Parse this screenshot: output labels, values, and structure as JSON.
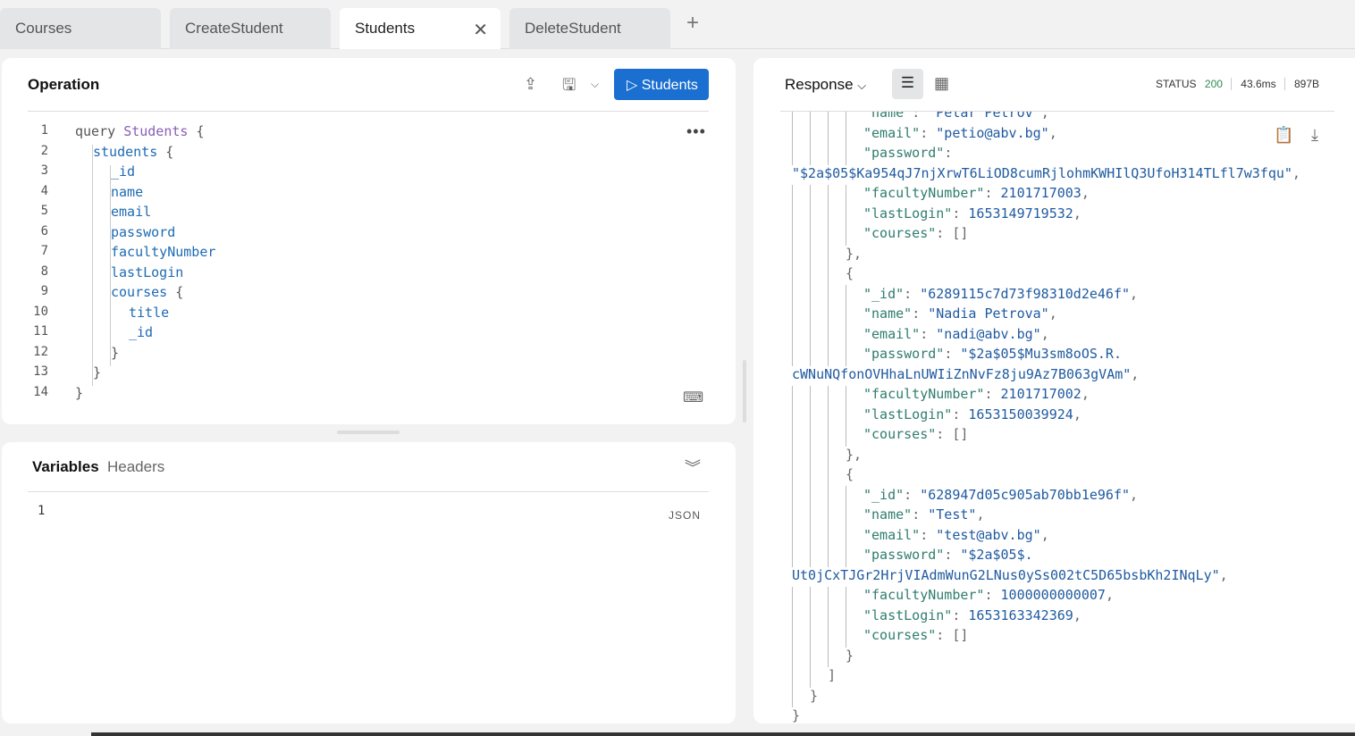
{
  "tabs": [
    {
      "label": "Courses"
    },
    {
      "label": "CreateStudent"
    },
    {
      "label": "Students",
      "active": true
    },
    {
      "label": "DeleteStudent"
    }
  ],
  "new_tab_icon": "plus-icon",
  "operation": {
    "title": "Operation",
    "run_label": "▷ Students",
    "more": "•••",
    "lines": [
      {
        "n": "1",
        "indent": 0,
        "tokens": [
          [
            "kw",
            "query "
          ],
          [
            "nm",
            "Students"
          ],
          [
            "kw",
            " {"
          ]
        ]
      },
      {
        "n": "2",
        "indent": 1,
        "tokens": [
          [
            "fd",
            "students"
          ],
          [
            "kw",
            " {"
          ]
        ]
      },
      {
        "n": "3",
        "indent": 2,
        "tokens": [
          [
            "fd",
            "_id"
          ]
        ]
      },
      {
        "n": "4",
        "indent": 2,
        "tokens": [
          [
            "fd",
            "name"
          ]
        ]
      },
      {
        "n": "5",
        "indent": 2,
        "tokens": [
          [
            "fd",
            "email"
          ]
        ]
      },
      {
        "n": "6",
        "indent": 2,
        "tokens": [
          [
            "fd",
            "password"
          ]
        ]
      },
      {
        "n": "7",
        "indent": 2,
        "tokens": [
          [
            "fd",
            "facultyNumber"
          ]
        ]
      },
      {
        "n": "8",
        "indent": 2,
        "tokens": [
          [
            "fd",
            "lastLogin"
          ]
        ]
      },
      {
        "n": "9",
        "indent": 2,
        "tokens": [
          [
            "fd",
            "courses"
          ],
          [
            "kw",
            " {"
          ]
        ]
      },
      {
        "n": "10",
        "indent": 3,
        "tokens": [
          [
            "fd",
            "title"
          ]
        ]
      },
      {
        "n": "11",
        "indent": 3,
        "tokens": [
          [
            "fd",
            "_id"
          ]
        ]
      },
      {
        "n": "12",
        "indent": 2,
        "tokens": [
          [
            "kw",
            "}"
          ]
        ]
      },
      {
        "n": "13",
        "indent": 1,
        "tokens": [
          [
            "kw",
            "}"
          ]
        ]
      },
      {
        "n": "14",
        "indent": 0,
        "tokens": [
          [
            "kw",
            "}"
          ]
        ]
      }
    ]
  },
  "variables": {
    "tab_variables": "Variables",
    "tab_headers": "Headers",
    "line": "1",
    "mode": "JSON"
  },
  "response": {
    "title": "Response",
    "status_label": "STATUS",
    "status": "200",
    "time": "43.6ms",
    "size": "897B",
    "colors": {
      "status": "#2e8b57",
      "key": "#2f7d6e",
      "value": "#1f5aa0"
    },
    "lines": [
      {
        "i": 4,
        "t": [
          [
            "key",
            "\"name\""
          ],
          [
            "pun",
            ": "
          ],
          [
            "val",
            "\"Petar Petrov\""
          ],
          [
            "pun",
            ","
          ]
        ]
      },
      {
        "i": 4,
        "t": [
          [
            "key",
            "\"email\""
          ],
          [
            "pun",
            ": "
          ],
          [
            "val",
            "\"petio@abv.bg\""
          ],
          [
            "pun",
            ","
          ]
        ]
      },
      {
        "i": 4,
        "t": [
          [
            "key",
            "\"password\""
          ],
          [
            "pun",
            ":"
          ]
        ]
      },
      {
        "i": 0,
        "t": [
          [
            "val",
            "\"$2a$05$Ka954qJ7njXrwT6LiOD8cumRjlohmKWHIlQ3UfoH314TLfl7w3fqu\""
          ],
          [
            "pun",
            ","
          ]
        ]
      },
      {
        "i": 4,
        "t": [
          [
            "key",
            "\"facultyNumber\""
          ],
          [
            "pun",
            ": "
          ],
          [
            "val",
            "2101717003"
          ],
          [
            "pun",
            ","
          ]
        ]
      },
      {
        "i": 4,
        "t": [
          [
            "key",
            "\"lastLogin\""
          ],
          [
            "pun",
            ": "
          ],
          [
            "val",
            "1653149719532"
          ],
          [
            "pun",
            ","
          ]
        ]
      },
      {
        "i": 4,
        "t": [
          [
            "key",
            "\"courses\""
          ],
          [
            "pun",
            ": []"
          ]
        ]
      },
      {
        "i": 3,
        "t": [
          [
            "pun",
            "},"
          ]
        ]
      },
      {
        "i": 3,
        "t": [
          [
            "pun",
            "{"
          ]
        ]
      },
      {
        "i": 4,
        "t": [
          [
            "key",
            "\"_id\""
          ],
          [
            "pun",
            ": "
          ],
          [
            "val",
            "\"6289115c7d73f98310d2e46f\""
          ],
          [
            "pun",
            ","
          ]
        ]
      },
      {
        "i": 4,
        "t": [
          [
            "key",
            "\"name\""
          ],
          [
            "pun",
            ": "
          ],
          [
            "val",
            "\"Nadia Petrova\""
          ],
          [
            "pun",
            ","
          ]
        ]
      },
      {
        "i": 4,
        "t": [
          [
            "key",
            "\"email\""
          ],
          [
            "pun",
            ": "
          ],
          [
            "val",
            "\"nadi@abv.bg\""
          ],
          [
            "pun",
            ","
          ]
        ]
      },
      {
        "i": 4,
        "t": [
          [
            "key",
            "\"password\""
          ],
          [
            "pun",
            ": "
          ],
          [
            "val",
            "\"$2a$05$Mu3sm8oOS.R."
          ]
        ]
      },
      {
        "i": 0,
        "t": [
          [
            "val",
            "cWNuNQfonOVHhaLnUWIiZnNvFz8ju9Az7B063gVAm\""
          ],
          [
            "pun",
            ","
          ]
        ]
      },
      {
        "i": 4,
        "t": [
          [
            "key",
            "\"facultyNumber\""
          ],
          [
            "pun",
            ": "
          ],
          [
            "val",
            "2101717002"
          ],
          [
            "pun",
            ","
          ]
        ]
      },
      {
        "i": 4,
        "t": [
          [
            "key",
            "\"lastLogin\""
          ],
          [
            "pun",
            ": "
          ],
          [
            "val",
            "1653150039924"
          ],
          [
            "pun",
            ","
          ]
        ]
      },
      {
        "i": 4,
        "t": [
          [
            "key",
            "\"courses\""
          ],
          [
            "pun",
            ": []"
          ]
        ]
      },
      {
        "i": 3,
        "t": [
          [
            "pun",
            "},"
          ]
        ]
      },
      {
        "i": 3,
        "t": [
          [
            "pun",
            "{"
          ]
        ]
      },
      {
        "i": 4,
        "t": [
          [
            "key",
            "\"_id\""
          ],
          [
            "pun",
            ": "
          ],
          [
            "val",
            "\"628947d05c905ab70bb1e96f\""
          ],
          [
            "pun",
            ","
          ]
        ]
      },
      {
        "i": 4,
        "t": [
          [
            "key",
            "\"name\""
          ],
          [
            "pun",
            ": "
          ],
          [
            "val",
            "\"Test\""
          ],
          [
            "pun",
            ","
          ]
        ]
      },
      {
        "i": 4,
        "t": [
          [
            "key",
            "\"email\""
          ],
          [
            "pun",
            ": "
          ],
          [
            "val",
            "\"test@abv.bg\""
          ],
          [
            "pun",
            ","
          ]
        ]
      },
      {
        "i": 4,
        "t": [
          [
            "key",
            "\"password\""
          ],
          [
            "pun",
            ": "
          ],
          [
            "val",
            "\"$2a$05$."
          ]
        ]
      },
      {
        "i": 0,
        "t": [
          [
            "val",
            "Ut0jCxTJGr2HrjVIAdmWunG2LNus0ySs002tC5D65bsbKh2INqLy\""
          ],
          [
            "pun",
            ","
          ]
        ]
      },
      {
        "i": 4,
        "t": [
          [
            "key",
            "\"facultyNumber\""
          ],
          [
            "pun",
            ": "
          ],
          [
            "val",
            "1000000000007"
          ],
          [
            "pun",
            ","
          ]
        ]
      },
      {
        "i": 4,
        "t": [
          [
            "key",
            "\"lastLogin\""
          ],
          [
            "pun",
            ": "
          ],
          [
            "val",
            "1653163342369"
          ],
          [
            "pun",
            ","
          ]
        ]
      },
      {
        "i": 4,
        "t": [
          [
            "key",
            "\"courses\""
          ],
          [
            "pun",
            ": []"
          ]
        ]
      },
      {
        "i": 3,
        "t": [
          [
            "pun",
            "}"
          ]
        ]
      },
      {
        "i": 2,
        "t": [
          [
            "pun",
            "]"
          ]
        ]
      },
      {
        "i": 1,
        "t": [
          [
            "pun",
            "}"
          ]
        ]
      },
      {
        "i": 0,
        "t": [
          [
            "pun",
            "}"
          ]
        ]
      }
    ]
  }
}
